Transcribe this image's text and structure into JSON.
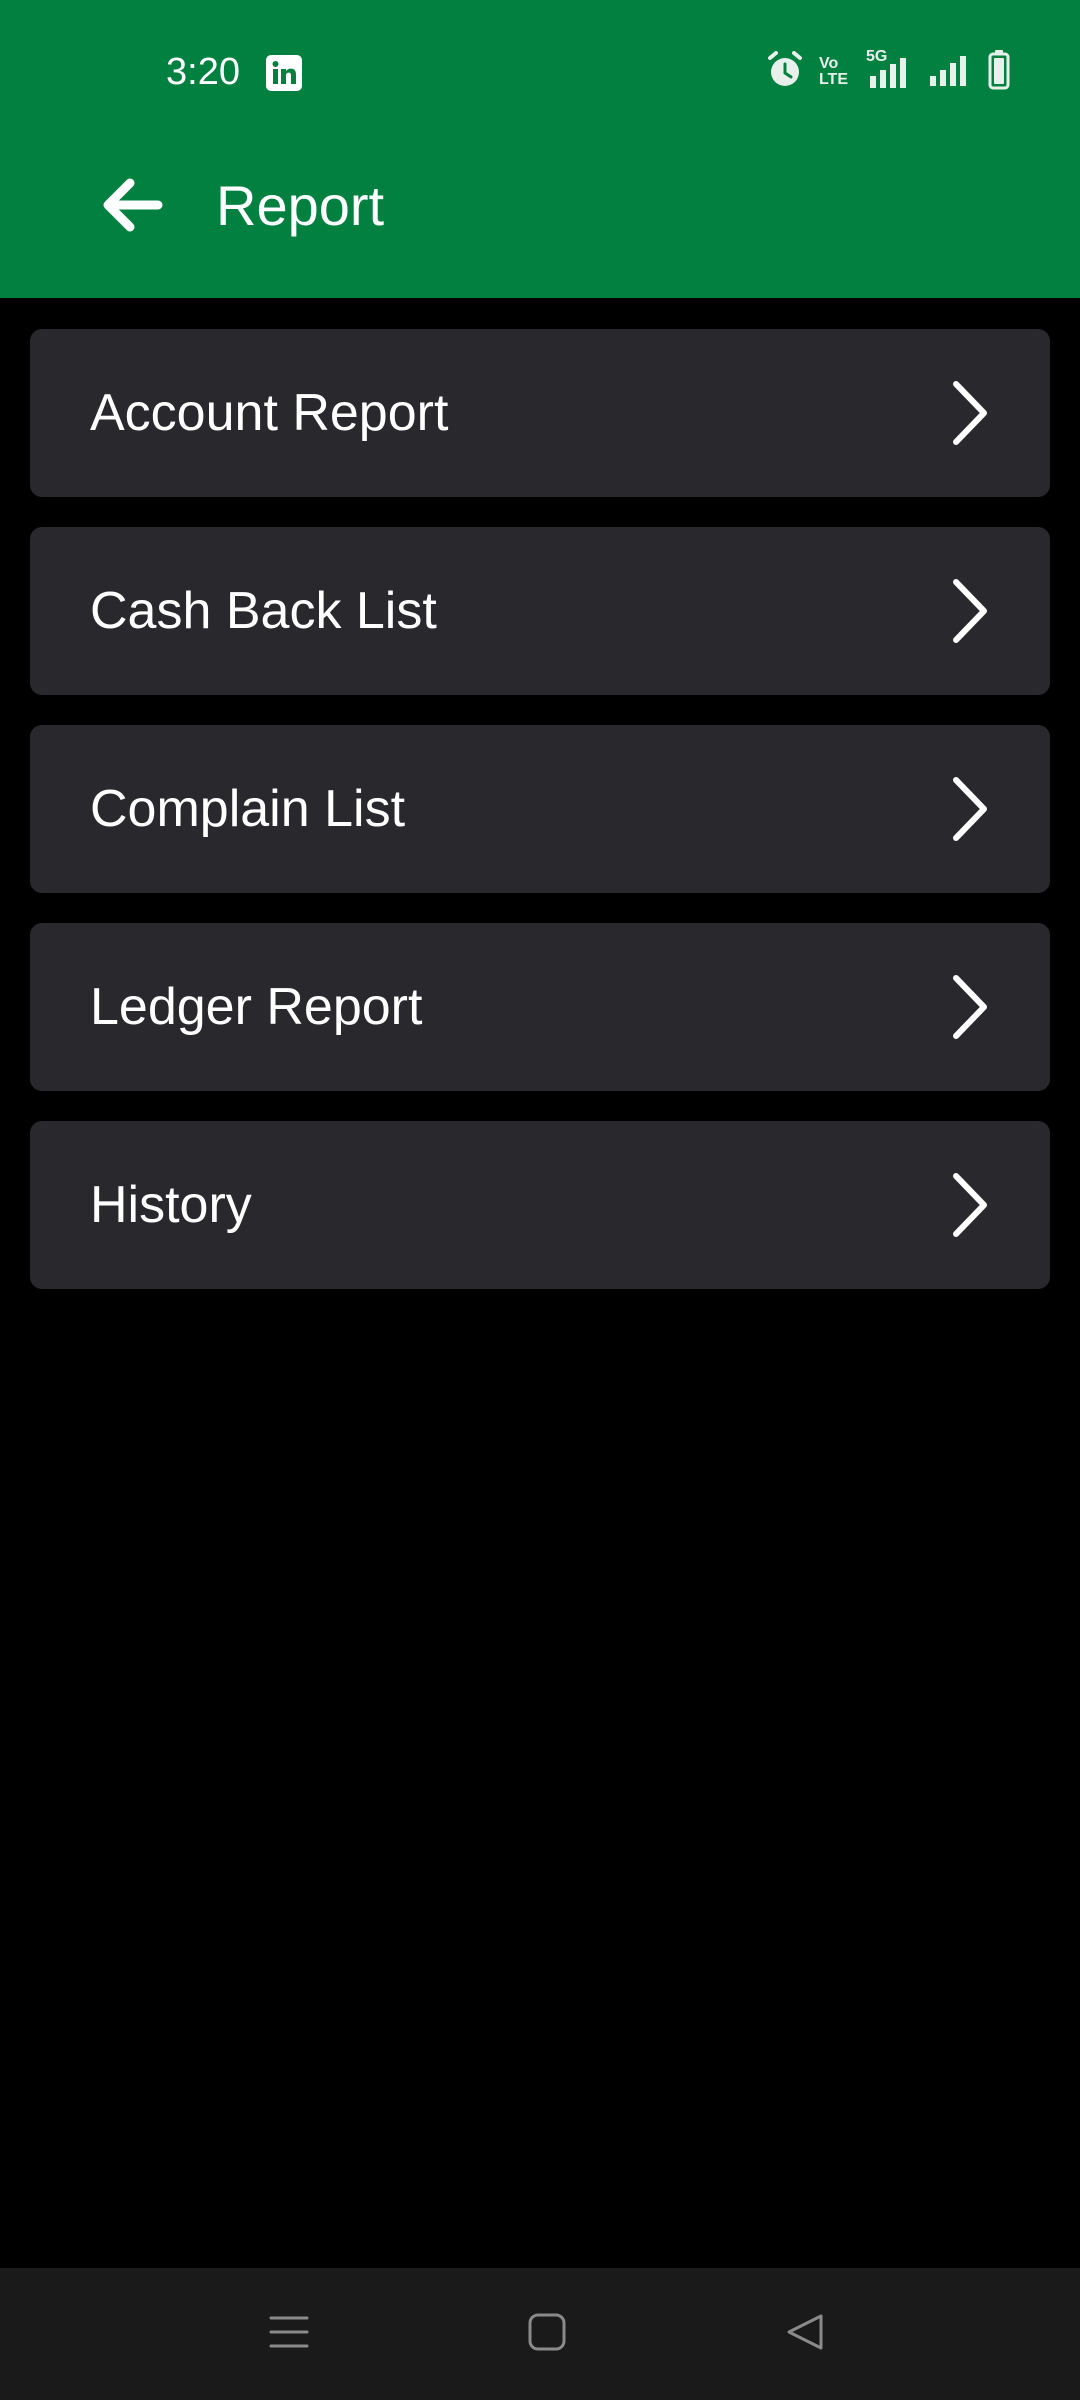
{
  "status_bar": {
    "time": "3:20",
    "notification_icon": "linkedin-icon",
    "icons": [
      "alarm-icon",
      "volte-icon",
      "5g-signal-icon",
      "signal-icon",
      "battery-icon"
    ],
    "volte_line1": "Vo",
    "volte_line2": "LTE",
    "network_label": "5G"
  },
  "app_bar": {
    "title": "Report",
    "back_icon": "arrow-left-icon",
    "background_color": "#018040"
  },
  "menu": {
    "items": [
      {
        "label": "Account Report",
        "icon": "chevron-right-icon"
      },
      {
        "label": "Cash Back List",
        "icon": "chevron-right-icon"
      },
      {
        "label": "Complain List",
        "icon": "chevron-right-icon"
      },
      {
        "label": "Ledger Report",
        "icon": "chevron-right-icon"
      },
      {
        "label": "History",
        "icon": "chevron-right-icon"
      }
    ],
    "item_background": "#29282d"
  },
  "nav_bar": {
    "buttons": [
      "menu-icon",
      "home-icon",
      "back-triangle-icon"
    ]
  }
}
